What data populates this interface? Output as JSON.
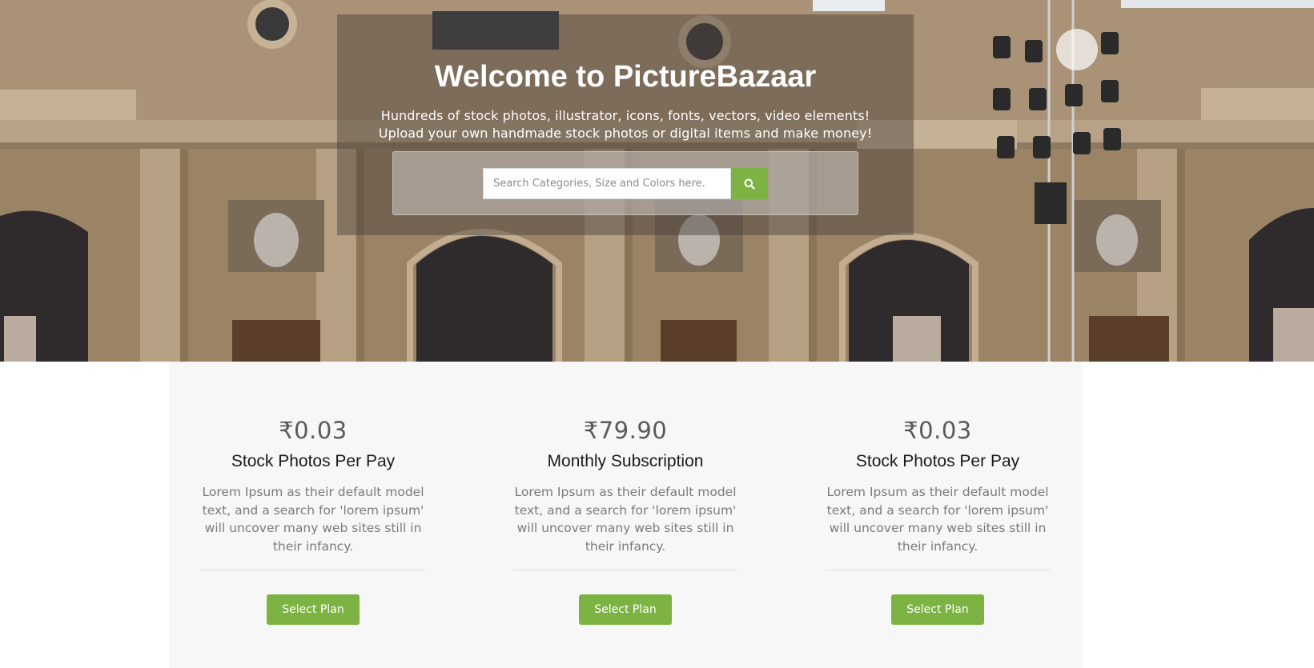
{
  "hero": {
    "title": "Welcome to PictureBazaar",
    "subtitle": "Hundreds of stock photos, illustrator, icons, fonts, vectors, video elements! Upload your own handmade stock photos or digital items and make money!",
    "search": {
      "placeholder": "Search Categories, Size and Colors here.",
      "value": "",
      "button_icon": "search-icon"
    },
    "background_image": "courtyard-building-photo"
  },
  "pricing": {
    "plans": [
      {
        "price": "₹0.03",
        "name": "Stock Photos Per Pay",
        "description": "Lorem Ipsum as their default model text, and a search for 'lorem ipsum' will uncover many web sites still in their infancy.",
        "button_label": "Select Plan"
      },
      {
        "price": "₹79.90",
        "name": "Monthly Subscription",
        "description": "Lorem Ipsum as their default model text, and a search for 'lorem ipsum' will uncover many web sites still in their infancy.",
        "button_label": "Select Plan"
      },
      {
        "price": "₹0.03",
        "name": "Stock Photos Per Pay",
        "description": "Lorem Ipsum as their default model text, and a search for 'lorem ipsum' will uncover many web sites still in their infancy.",
        "button_label": "Select Plan"
      }
    ]
  },
  "colors": {
    "accent": "#7cb342",
    "price_text": "#5a5a5a",
    "description_text": "#7a7a7a",
    "pricing_background": "#f7f7f7"
  }
}
